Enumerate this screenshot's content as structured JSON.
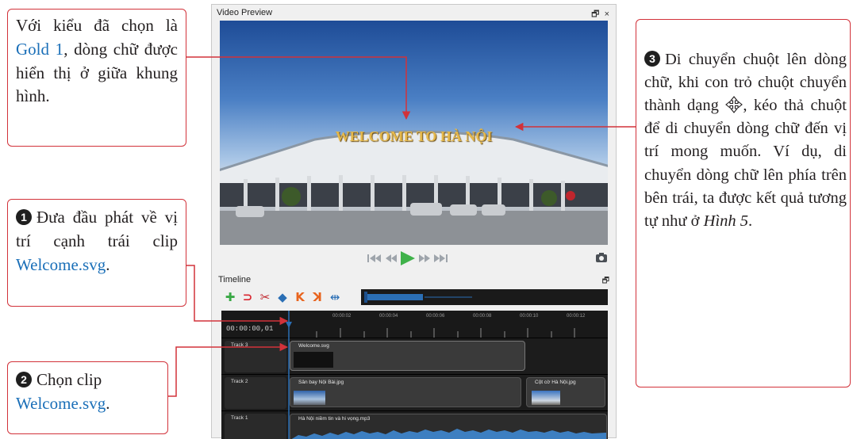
{
  "app": {
    "preview_title": "Video Preview",
    "pin_icon": "pin-icon",
    "close_icon": "close-icon",
    "preview_text": "WELCOME TO HÀ NỘI",
    "timeline_title": "Timeline",
    "timecode": "00:00:00,01",
    "ruler_ticks": [
      "00:00:02",
      "00:00:04",
      "00:00:06",
      "00:00:08",
      "00:00:10",
      "00:00:12"
    ],
    "playback_controls": [
      "jump-start-icon",
      "rewind-icon",
      "play-icon",
      "fast-forward-icon",
      "jump-end-icon"
    ],
    "snapshot_icon": "camera-icon",
    "toolbar_icons": [
      "add-track-icon",
      "snap-icon",
      "razor-icon",
      "add-marker-icon",
      "previous-marker-icon",
      "next-marker-icon",
      "center-playhead-icon"
    ],
    "tracks": [
      {
        "name": "Track 3",
        "clips": [
          {
            "title": "Welcome.svg"
          }
        ]
      },
      {
        "name": "Track 2",
        "clips": [
          {
            "title": "Sân bay Nội Bài.jpg"
          },
          {
            "title": "Cột cờ Hà Nội.jpg"
          }
        ]
      },
      {
        "name": "Track 1",
        "clips": [
          {
            "title": "Hà Nội niềm tin và hi vọng.mp3"
          }
        ]
      }
    ],
    "colors": {
      "accent": "#d2323a",
      "highlight": "#1a6fb8",
      "play": "#3fb24a",
      "title_gold": "#e5b84b"
    }
  },
  "callouts": {
    "top_left": {
      "pre": "Với kiểu đã chọn là ",
      "highlight": "Gold 1",
      "post": ", dòng chữ được hiển thị ở giữa khung hình."
    },
    "step1": {
      "number": "1",
      "pre": "Đưa đầu phát về vị trí cạnh trái clip ",
      "highlight": "Welcome.svg",
      "post": "."
    },
    "step2": {
      "number": "2",
      "pre": "Chọn clip ",
      "highlight": "Welcome.svg",
      "post": "."
    },
    "step3": {
      "number": "3",
      "text_a": "Di chuyển chuột lên dòng chữ, khi con trỏ chuột chuyển thành dạng ",
      "cursor_icon": "move-cursor-icon",
      "text_b": ", kéo thả chuột để di chuyển dòng chữ đến vị trí mong muốn. Ví dụ, di chuyển dòng chữ lên phía trên bên trái, ta được kết quả tương tự như ở ",
      "emph": "Hình 5",
      "end": "."
    }
  }
}
